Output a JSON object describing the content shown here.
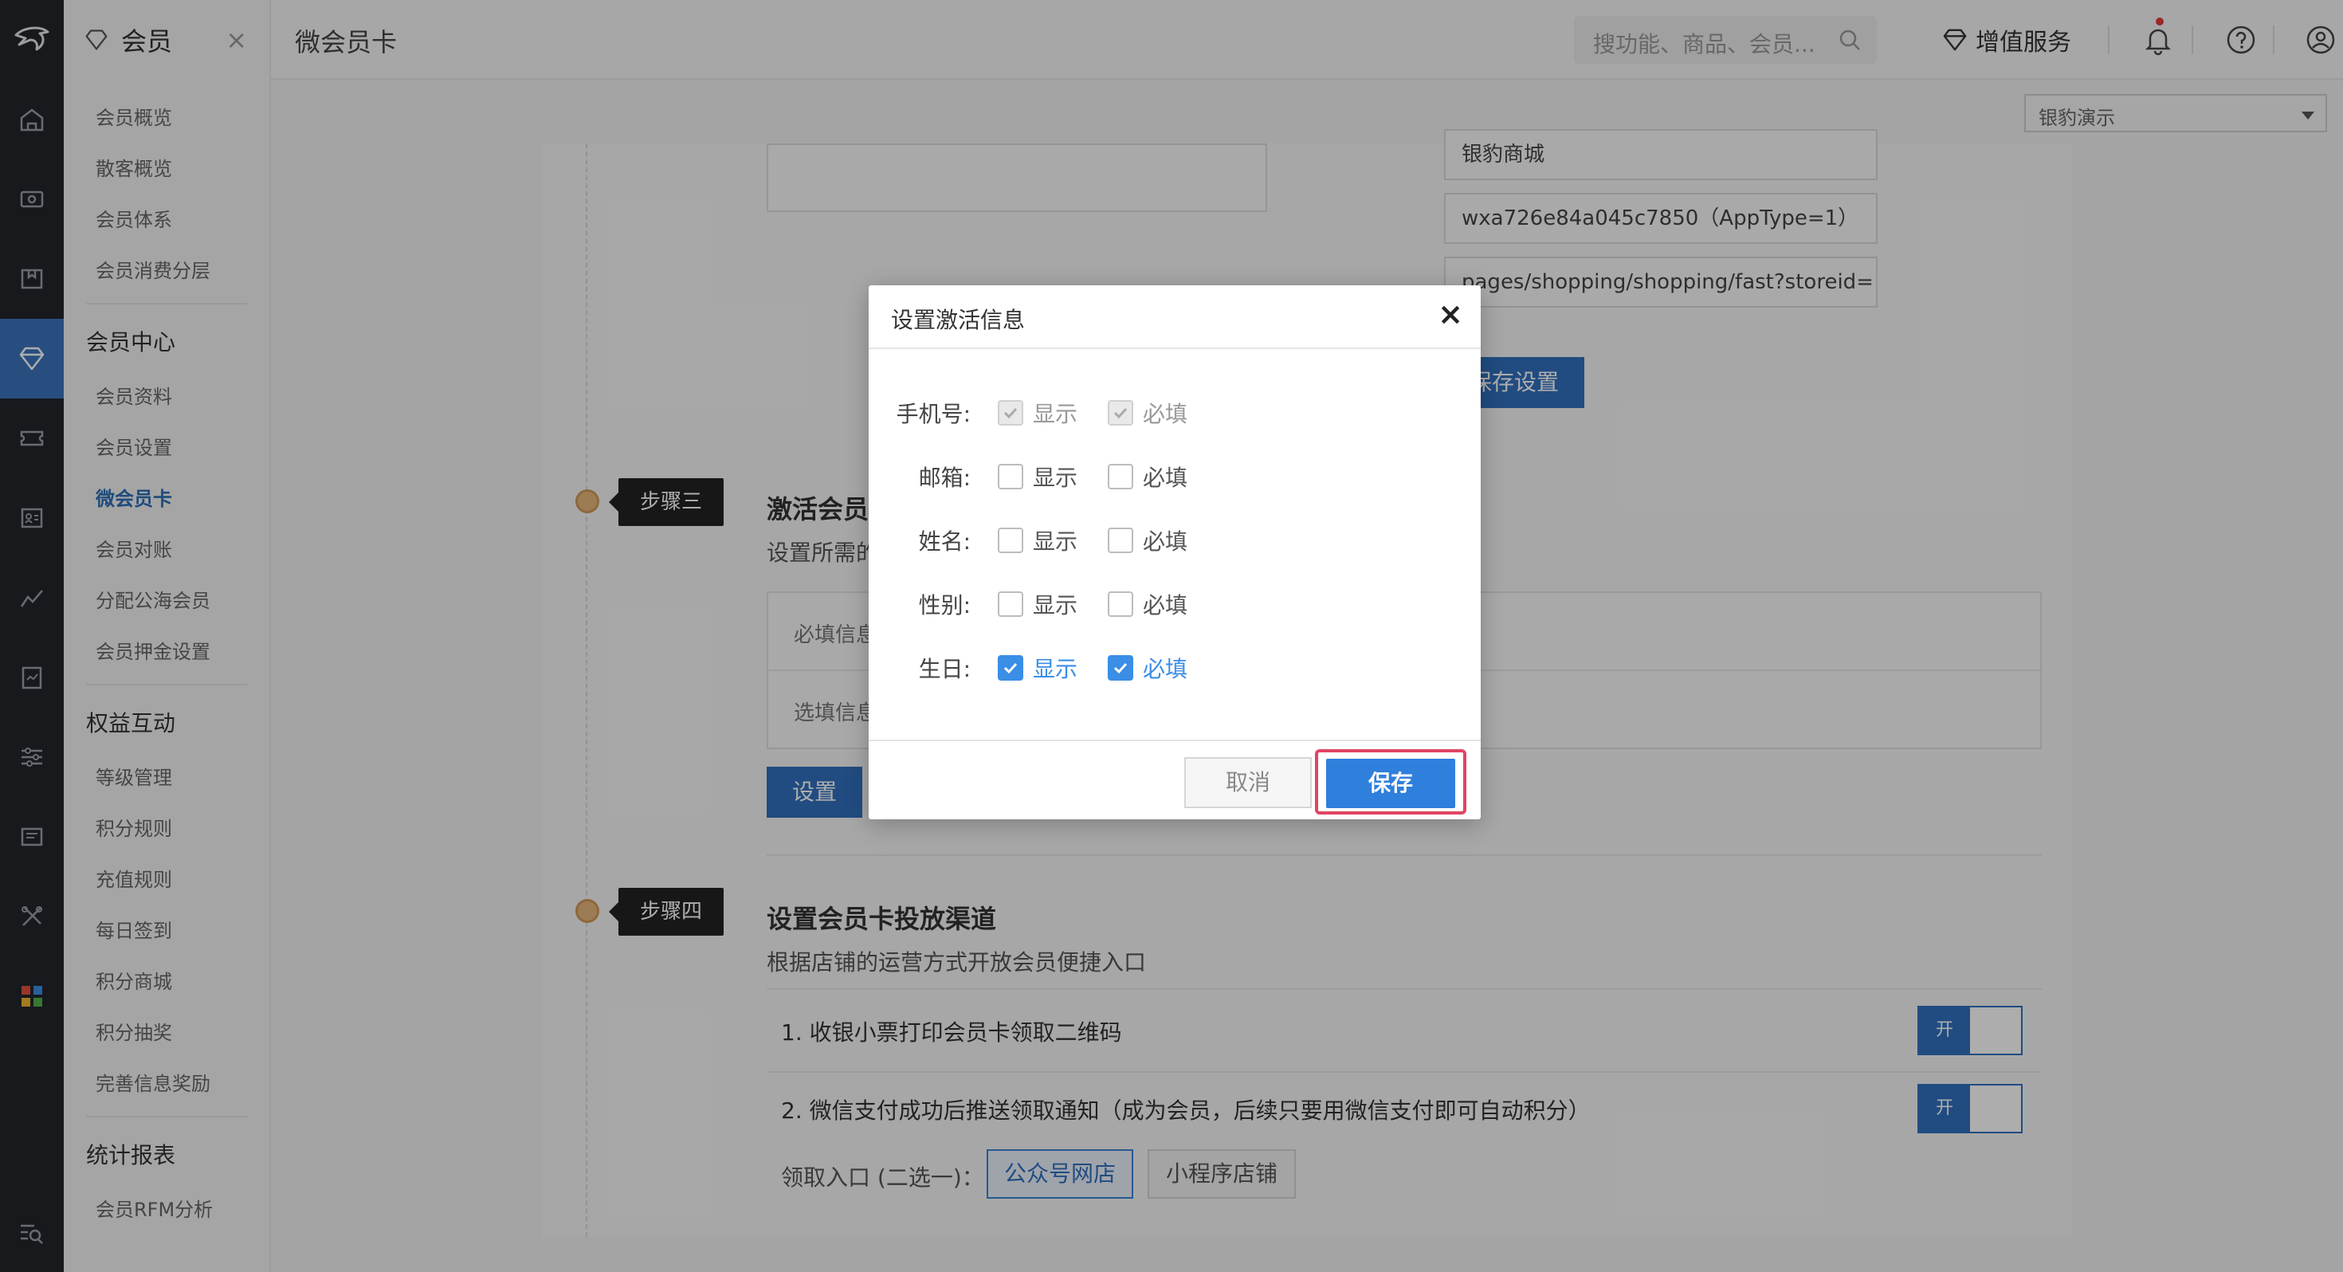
{
  "submenu": {
    "title": "会员",
    "close": "×",
    "top_items": [
      "会员概览",
      "散客概览",
      "会员体系",
      "会员消费分层"
    ],
    "groups": [
      {
        "title": "会员中心",
        "items": [
          "会员资料",
          "会员设置",
          "微会员卡",
          "会员对账",
          "分配公海会员",
          "会员押金设置"
        ]
      },
      {
        "title": "权益互动",
        "items": [
          "等级管理",
          "积分规则",
          "充值规则",
          "每日签到",
          "积分商城",
          "积分抽奖",
          "完善信息奖励"
        ]
      },
      {
        "title": "统计报表",
        "items": [
          "会员RFM分析"
        ]
      }
    ]
  },
  "header": {
    "page_title": "微会员卡",
    "search_placeholder": "搜功能、商品、会员...",
    "value_service": "增值服务",
    "store": "银豹演示"
  },
  "colors": {
    "accent": "#3270be",
    "highlight": "#e04563",
    "checked": "#3a8ee6"
  },
  "form": {
    "store_name": "银豹商城",
    "app_id": "wxa726e84a045c7850（AppType=1）",
    "page_path": "pages/shopping/shopping/fast?storeid={sto",
    "save_settings": "保存设置"
  },
  "step3": {
    "tag": "步骤三",
    "title": "激活会员",
    "desc": "设置所需的",
    "required_row": "必填信息",
    "optional_row": "选填信息",
    "set_button": "设置"
  },
  "step4": {
    "tag": "步骤四",
    "title": "设置会员卡投放渠道",
    "desc": "根据店铺的运营方式开放会员便捷入口",
    "channels": [
      {
        "label": "1. 收银小票打印会员卡领取二维码",
        "toggle": "开"
      },
      {
        "label": "2. 微信支付成功后推送领取通知（成为会员，后续只要用微信支付即可自动积分）",
        "toggle": "开"
      }
    ],
    "entry_label": "领取入口 (二选一)：",
    "entry_options": [
      "公众号网店",
      "小程序店铺"
    ]
  },
  "modal": {
    "title": "设置激活信息",
    "close": "×",
    "show_label": "显示",
    "required_label": "必填",
    "fields": [
      {
        "label": "手机号:",
        "state": "disabled"
      },
      {
        "label": "邮箱:",
        "state": "off"
      },
      {
        "label": "姓名:",
        "state": "off"
      },
      {
        "label": "性别:",
        "state": "off"
      },
      {
        "label": "生日:",
        "state": "on"
      }
    ],
    "cancel": "取消",
    "save": "保存"
  }
}
